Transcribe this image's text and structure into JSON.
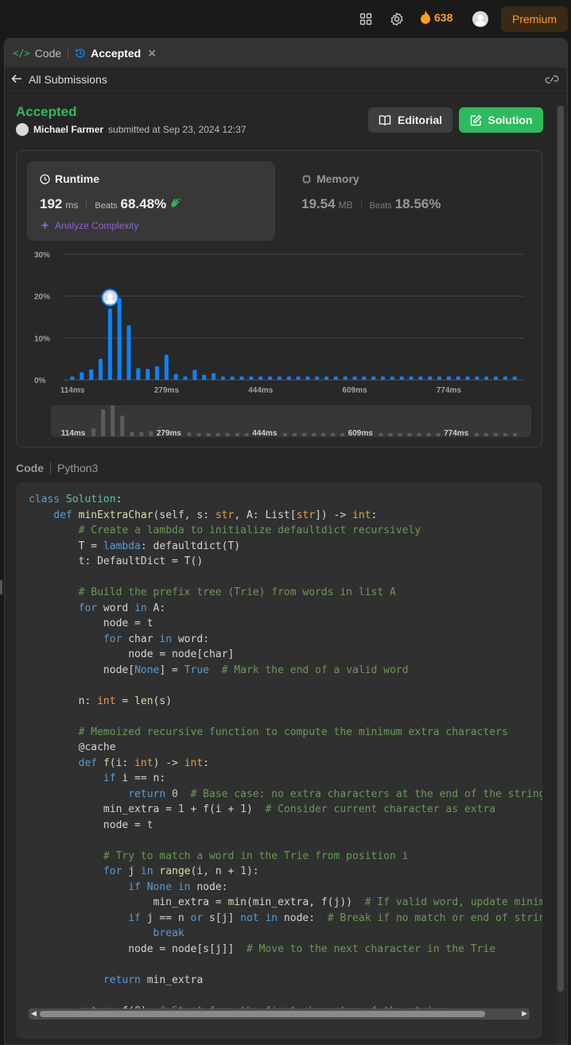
{
  "topbar": {
    "streak_count": "638",
    "premium_label": "Premium"
  },
  "tabs": {
    "code_label": "Code",
    "accepted_label": "Accepted"
  },
  "nav": {
    "back_label": "All Submissions"
  },
  "submission": {
    "status": "Accepted",
    "user_name": "Michael Farmer",
    "submitted_text": "submitted at Sep 23, 2024 12:37"
  },
  "buttons": {
    "editorial_label": "Editorial",
    "solution_label": "Solution"
  },
  "runtime": {
    "label": "Runtime",
    "value": "192",
    "unit": "ms",
    "beats_label": "Beats",
    "beats_value": "68.48%",
    "analyze_label": "Analyze Complexity"
  },
  "memory": {
    "label": "Memory",
    "value": "19.54",
    "unit": "MB",
    "beats_label": "Beats",
    "beats_value": "18.56%"
  },
  "chart_data": {
    "type": "bar",
    "y_tick_labels": [
      "30%",
      "20%",
      "10%",
      "0%"
    ],
    "ylim": [
      0,
      30
    ],
    "x_tick_labels": [
      "114ms",
      "279ms",
      "444ms",
      "609ms",
      "774ms"
    ],
    "x_tick_index": [
      0,
      10,
      20,
      30,
      40
    ],
    "values": [
      0.8,
      1.8,
      2.5,
      5,
      17,
      19.5,
      13,
      2.8,
      2.6,
      3.2,
      6,
      1.4,
      0.8,
      2.4,
      1.2,
      1.6,
      0.8,
      0.8,
      0.8,
      0.8,
      0.8,
      0.8,
      0.8,
      0.8,
      0.8,
      0.8,
      0.8,
      0.8,
      0.8,
      0.8,
      0.8,
      0.8,
      0.8,
      0.8,
      0.8,
      0.8,
      0.8,
      0.8,
      0.8,
      0.8,
      0.8,
      0.8,
      0.8,
      0.8,
      0.8,
      0.8,
      0.8,
      0.8
    ],
    "user_bar_index": 4,
    "bar_color": "#0a84ff"
  },
  "code": {
    "label": "Code",
    "language": "Python3"
  },
  "colors": {
    "accepted": "#2cbb5d",
    "premium": "#ffa116",
    "analyze": "#8a63d2"
  }
}
